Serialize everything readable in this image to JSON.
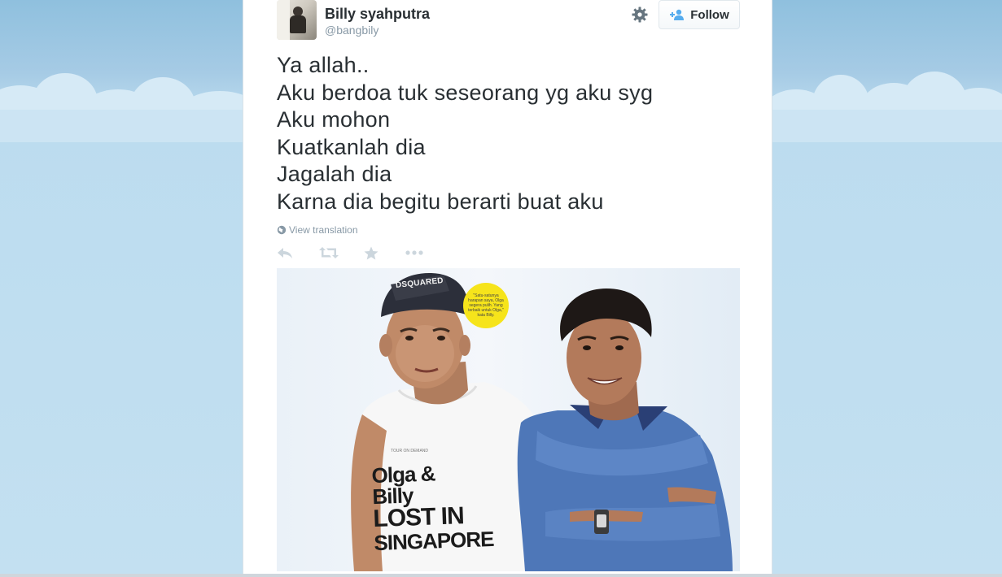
{
  "tweet": {
    "author_name": "Billy syahputra",
    "author_handle": "@bangbily",
    "follow_label": "Follow",
    "lines": [
      "Ya allah..",
      "Aku berdoa tuk seseorang yg aku syg",
      "Aku mohon",
      "Kuatkanlah dia",
      "Jagalah dia",
      "Karna dia begitu berarti buat aku"
    ],
    "translate_label": "View translation",
    "actions": [
      "reply-icon",
      "retweet-icon",
      "favorite-icon",
      "more-icon"
    ]
  },
  "photo": {
    "cap_text": "DSQUARED",
    "bubble_text": "\"Satu-satunya harapan saya, Olga segera pulih. Yang terbaik untuk Olga,\" kata Billy.",
    "shirt_small": "TOUR ON DEMAND",
    "shirt_line1": "Olga & Billy",
    "shirt_line2": "LOST IN",
    "shirt_line3": "SINGAPORE"
  },
  "colors": {
    "accent": "#55acee",
    "text": "#292f33",
    "muted": "#8899a6",
    "sky": "#a9cde6"
  }
}
